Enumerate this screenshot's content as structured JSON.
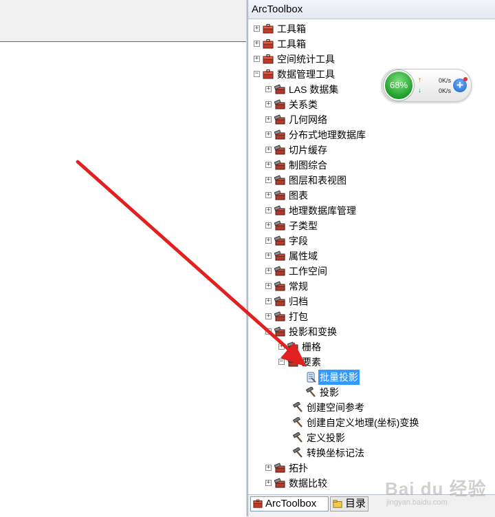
{
  "toolbox": {
    "title": "ArcToolbox"
  },
  "tree": [
    {
      "label": "工具箱",
      "level": 0,
      "expander": "+",
      "icon": "toolbox"
    },
    {
      "label": "工具箱",
      "level": 0,
      "expander": "+",
      "icon": "toolbox"
    },
    {
      "label": "空间统计工具",
      "level": 0,
      "expander": "+",
      "icon": "toolbox"
    },
    {
      "label": "数据管理工具",
      "level": 0,
      "expander": "-",
      "icon": "toolbox"
    },
    {
      "label": "LAS 数据集",
      "level": 1,
      "expander": "+",
      "icon": "toolset"
    },
    {
      "label": "关系类",
      "level": 1,
      "expander": "+",
      "icon": "toolset"
    },
    {
      "label": "几何网络",
      "level": 1,
      "expander": "+",
      "icon": "toolset"
    },
    {
      "label": "分布式地理数据库",
      "level": 1,
      "expander": "+",
      "icon": "toolset"
    },
    {
      "label": "切片缓存",
      "level": 1,
      "expander": "+",
      "icon": "toolset"
    },
    {
      "label": "制图综合",
      "level": 1,
      "expander": "+",
      "icon": "toolset"
    },
    {
      "label": "图层和表视图",
      "level": 1,
      "expander": "+",
      "icon": "toolset"
    },
    {
      "label": "图表",
      "level": 1,
      "expander": "+",
      "icon": "toolset"
    },
    {
      "label": "地理数据库管理",
      "level": 1,
      "expander": "+",
      "icon": "toolset"
    },
    {
      "label": "子类型",
      "level": 1,
      "expander": "+",
      "icon": "toolset"
    },
    {
      "label": "字段",
      "level": 1,
      "expander": "+",
      "icon": "toolset"
    },
    {
      "label": "属性域",
      "level": 1,
      "expander": "+",
      "icon": "toolset"
    },
    {
      "label": "工作空间",
      "level": 1,
      "expander": "+",
      "icon": "toolset"
    },
    {
      "label": "常规",
      "level": 1,
      "expander": "+",
      "icon": "toolset"
    },
    {
      "label": "归档",
      "level": 1,
      "expander": "+",
      "icon": "toolset"
    },
    {
      "label": "打包",
      "level": 1,
      "expander": "+",
      "icon": "toolset"
    },
    {
      "label": "投影和变换",
      "level": 1,
      "expander": "-",
      "icon": "toolset"
    },
    {
      "label": "栅格",
      "level": 2,
      "expander": "+",
      "icon": "toolset"
    },
    {
      "label": "要素",
      "level": 2,
      "expander": "-",
      "icon": "toolset"
    },
    {
      "label": "批量投影",
      "level": 3,
      "expander": "",
      "icon": "script",
      "selected": true
    },
    {
      "label": "投影",
      "level": 3,
      "expander": "",
      "icon": "tool"
    },
    {
      "label": "创建空间参考",
      "level": 2,
      "expander": "",
      "icon": "tool"
    },
    {
      "label": "创建自定义地理(坐标)变换",
      "level": 2,
      "expander": "",
      "icon": "tool"
    },
    {
      "label": "定义投影",
      "level": 2,
      "expander": "",
      "icon": "tool"
    },
    {
      "label": "转换坐标记法",
      "level": 2,
      "expander": "",
      "icon": "tool"
    },
    {
      "label": "拓扑",
      "level": 1,
      "expander": "+",
      "icon": "toolset"
    },
    {
      "label": "数据比较",
      "level": 1,
      "expander": "+",
      "icon": "toolset"
    }
  ],
  "tabs": {
    "arctoolbox": "ArcToolbox",
    "catalog": "目录"
  },
  "netmon": {
    "percent": "68%",
    "upload": "0K/s",
    "download": "0K/s",
    "arrow_up": "↑",
    "arrow_down": "↓",
    "plus": "+"
  },
  "watermark": {
    "text": "Bai du 经验",
    "sub": "jingyan.baidu.com"
  },
  "colors": {
    "selection": "#3399ff",
    "annotation_arrow": "#e32020",
    "gauge": "#1f9e2c"
  }
}
